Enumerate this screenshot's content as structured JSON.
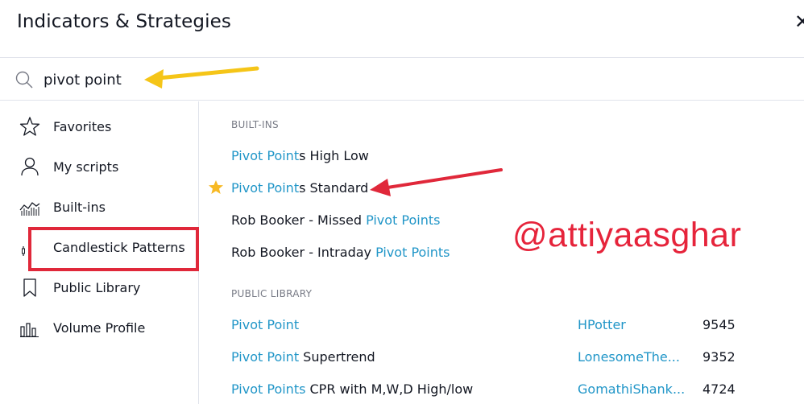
{
  "header": {
    "title": "Indicators & Strategies",
    "close_icon": "close-icon"
  },
  "search": {
    "value": "pivot point",
    "placeholder": "Search"
  },
  "sidebar": {
    "items": [
      {
        "label": "Favorites",
        "icon": "star-outline-icon"
      },
      {
        "label": "My scripts",
        "icon": "user-icon"
      },
      {
        "label": "Built-ins",
        "icon": "chart-area-icon"
      },
      {
        "label": "Candlestick Patterns",
        "icon": "candlestick-icon"
      },
      {
        "label": "Public Library",
        "icon": "bookmark-icon"
      },
      {
        "label": "Volume Profile",
        "icon": "volume-bars-icon"
      }
    ]
  },
  "builtins": {
    "heading": "BUILT-INS",
    "rows": [
      {
        "hl": "Pivot Point",
        "pre": "",
        "post": "s High Low",
        "favorite": false
      },
      {
        "hl": "Pivot Point",
        "pre": "",
        "post": "s Standard",
        "favorite": true
      },
      {
        "pre": "Rob Booker - Missed ",
        "hl": "Pivot Points",
        "post": "",
        "favorite": false
      },
      {
        "pre": "Rob Booker - Intraday ",
        "hl": "Pivot Points",
        "post": "",
        "favorite": false
      }
    ]
  },
  "public_library": {
    "heading": "PUBLIC LIBRARY",
    "rows": [
      {
        "hl": "Pivot Point",
        "post": "",
        "author": "HPotter",
        "count": "9545"
      },
      {
        "hl": "Pivot Point",
        "post": " Supertrend",
        "author": "LonesomeThe...",
        "count": "9352"
      },
      {
        "hl": "Pivot Points",
        "post": " CPR with M,W,D High/low",
        "author": "GomathiShank...",
        "count": "4724"
      }
    ]
  },
  "watermark": "@attiyaasghar",
  "colors": {
    "accent": "#2196c8",
    "annotation_red": "#e0283a",
    "annotation_yellow": "#f5c518",
    "star": "#f7b924"
  }
}
